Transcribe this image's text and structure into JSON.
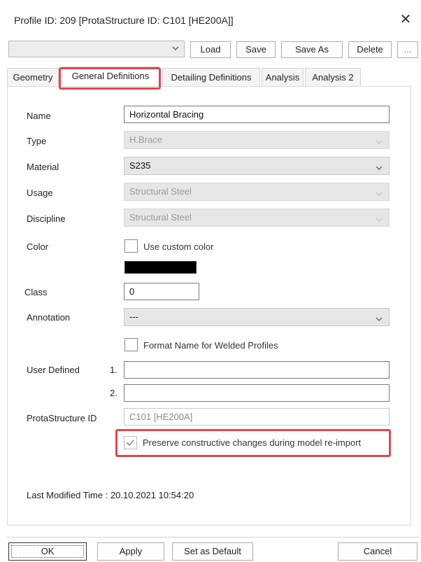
{
  "window": {
    "title": "Profile ID: 209 [ProtaStructure ID: C101 [HE200A]]",
    "close_symbol": "✕"
  },
  "toolbar": {
    "preset_value": "",
    "load_label": "Load",
    "save_label": "Save",
    "save_as_label": "Save As",
    "delete_label": "Delete",
    "more_label": "..."
  },
  "tabs": [
    {
      "label": "Geometry"
    },
    {
      "label": "General Definitions",
      "active": true
    },
    {
      "label": "Detailing Definitions"
    },
    {
      "label": "Analysis"
    },
    {
      "label": "Analysis 2"
    }
  ],
  "form": {
    "name": {
      "label": "Name",
      "value": "Horizontal Bracing"
    },
    "type": {
      "label": "Type",
      "value": "H.Brace",
      "enabled": false
    },
    "material": {
      "label": "Material",
      "value": "S235",
      "enabled": true
    },
    "usage": {
      "label": "Usage",
      "value": "Structural Steel",
      "enabled": false
    },
    "discipline": {
      "label": "Discipline",
      "value": "Structural Steel",
      "enabled": false
    },
    "color": {
      "label": "Color",
      "custom_color_label": "Use custom color",
      "custom_color_checked": false,
      "swatch_color": "#000000"
    },
    "class": {
      "label": "Class",
      "value": "0"
    },
    "annotation": {
      "label": "Annotation",
      "value": "---",
      "enabled": true
    },
    "format_name": {
      "label": "Format Name for Welded Profiles",
      "checked": false
    },
    "user_defined": {
      "label": "User Defined",
      "row1_index": "1.",
      "row1_value": "",
      "row2_index": "2.",
      "row2_value": ""
    },
    "prota_id": {
      "label": "ProtaStructure ID",
      "value": "C101 [HE200A]"
    },
    "preserve": {
      "label": "Preserve constructive changes during model re-import",
      "checked": true
    },
    "last_modified": "Last Modified Time : 20.10.2021 10:54:20"
  },
  "footer": {
    "ok_label": "OK",
    "apply_label": "Apply",
    "default_label": "Set as Default",
    "cancel_label": "Cancel"
  },
  "colors": {
    "highlight": "#e2484c",
    "disabled_bg": "#e6e6e6"
  }
}
